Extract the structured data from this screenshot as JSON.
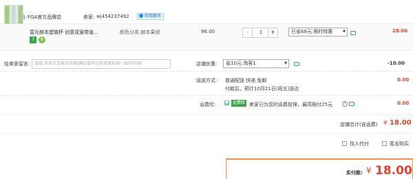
{
  "store": {
    "label": "店铺:",
    "name": "FGA官方品牌店",
    "seller_label": "卖家:",
    "seller_name": "wj454237492",
    "chat_label": "和我联系"
  },
  "item": {
    "title": "富光赫本塑玻杯 创意双层带盖...",
    "badge_7": "7",
    "badge_b": "B",
    "sku": "颜色分类:赫本果绿",
    "price": "96.00",
    "quantity": "1",
    "minus": "-",
    "plus": "+",
    "promo_selected": "已省68元:限时特惠",
    "subtotal": "28.00"
  },
  "message": {
    "label": "给卖家留言:",
    "placeholder": "选填:对本次交易的说明(建议填写已和卖家协商一致的内容)"
  },
  "discount": {
    "label": "店铺优惠:",
    "selected": "省10元:淘客1",
    "amount": "-10.00"
  },
  "shipping": {
    "label": "运送方式:",
    "method": "普通配送 快递 免邮",
    "eta": "付款后，预计10月21日(周五)送达",
    "amount": "0.00"
  },
  "insurance": {
    "label": "运费险:",
    "tag": "运费险",
    "text": "卖家已为您的运费投保，最高赔付25元",
    "amount": "0.00"
  },
  "total": {
    "label": "店铺合计(含运费)",
    "currency": "¥",
    "amount": "18.00"
  },
  "options": {
    "agent_pay": "找人代付",
    "anonymous": "匿名购买"
  },
  "final": {
    "label": "实付款:",
    "currency": "¥",
    "amount": "18.00"
  },
  "icons": [
    "store-icon",
    "chat-icon",
    "help-icon",
    "checkbox"
  ]
}
